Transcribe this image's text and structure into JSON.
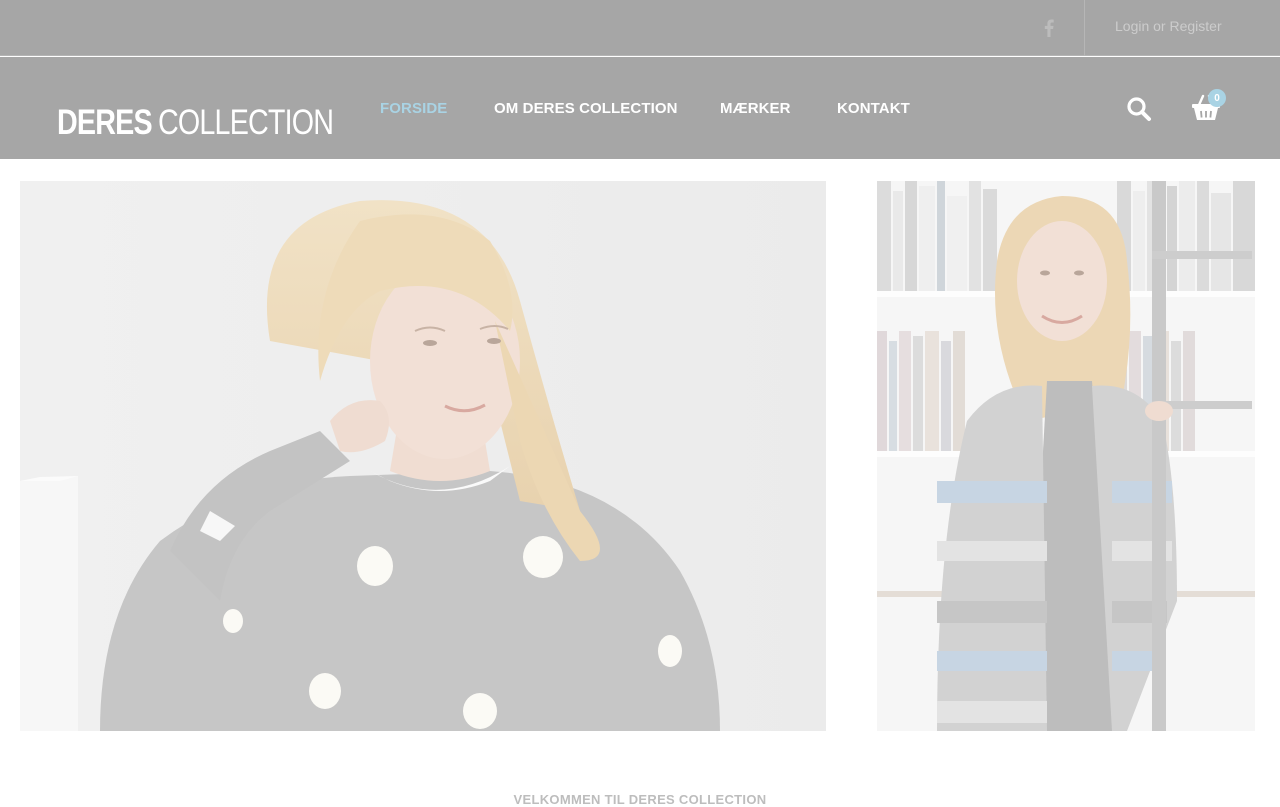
{
  "topbar": {
    "social_icon": "facebook-icon",
    "login_label": "Login or Register"
  },
  "header": {
    "logo": {
      "strong": "DERES",
      "light": "COLLECTION"
    },
    "nav": [
      {
        "label": "FORSIDE",
        "active": true
      },
      {
        "label": "OM DERES COLLECTION",
        "active": false
      },
      {
        "label": "MÆRKER",
        "active": false
      },
      {
        "label": "KONTAKT",
        "active": false
      }
    ],
    "search_icon": "search-icon",
    "cart_icon": "shopping-basket-icon",
    "cart_count": "0"
  },
  "hero": {
    "left_image": "woman-grey-polka-dot-sweater-photo",
    "right_image": "woman-striped-cardigan-bookshelf-photo"
  },
  "welcome_heading": "VELKOMMEN TIL DERES COLLECTION",
  "colors": {
    "header_bg": "#a6a6a6",
    "accent": "#a9d3e4",
    "nav_text": "#ffffff"
  }
}
